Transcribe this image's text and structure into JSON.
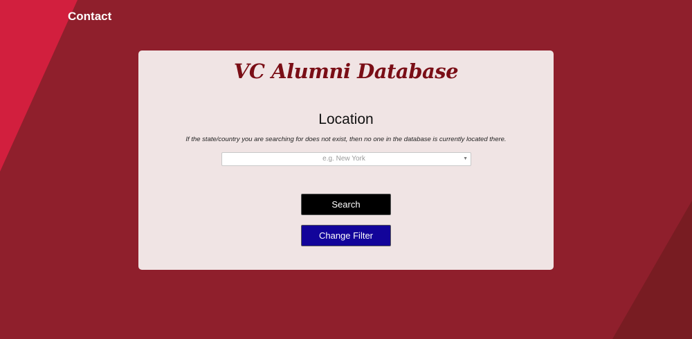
{
  "nav": {
    "contact_label": "Contact"
  },
  "panel": {
    "title": "VC Alumni Database",
    "section_heading": "Location",
    "note": "If the state/country you are searching for does not exist, then no one in the database is currently located there.",
    "location_select": {
      "placeholder": "e.g. New York",
      "arrow_icon": "caret-down-icon"
    },
    "search_button_label": "Search",
    "change_filter_button_label": "Change Filter"
  },
  "colors": {
    "background": "#8f1f2c",
    "accent_left": "#d21f3e",
    "accent_right": "#781c22",
    "panel": "#f0e4e4",
    "title": "#7a0e16",
    "search_button": "#000000",
    "change_filter_button": "#12049a"
  }
}
